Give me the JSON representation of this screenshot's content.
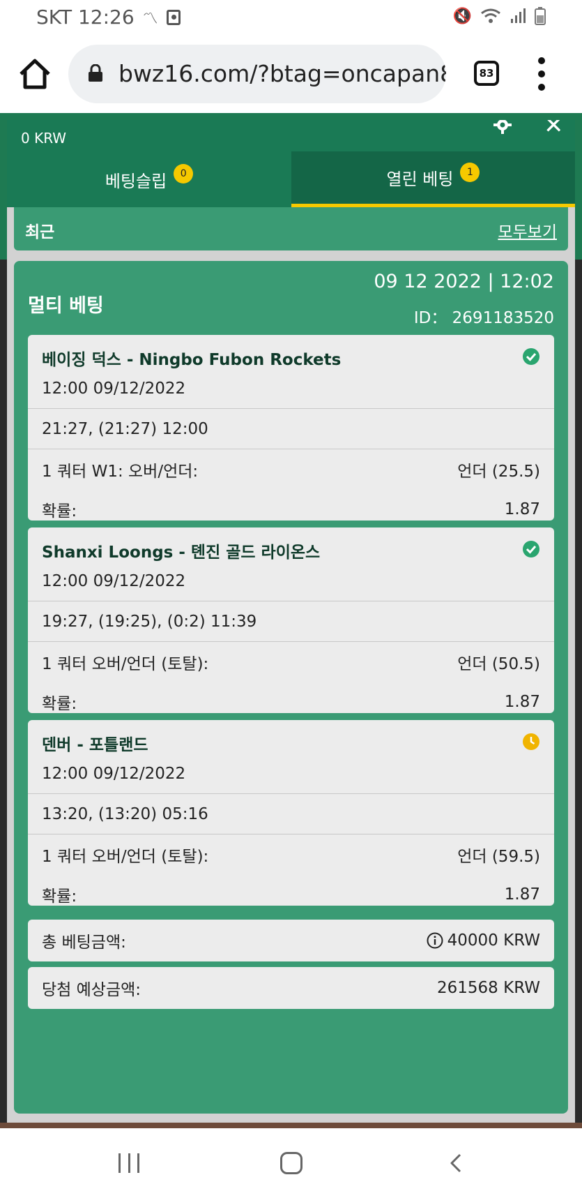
{
  "status_bar": {
    "carrier_time": "SKT 12:26",
    "icons": [
      "handwriting-icon",
      "screen-record-icon",
      "mute-icon",
      "wifi-icon",
      "signal-icon",
      "battery-icon"
    ]
  },
  "browser": {
    "url": "bwz16.com/?btag=oncapan8",
    "tab_count": "83"
  },
  "panel": {
    "balance": "0 KRW",
    "tabs": [
      {
        "label": "베팅슬립",
        "badge": "0"
      },
      {
        "label": "열린 베팅",
        "badge": "1"
      }
    ],
    "recent_title": "최근",
    "view_all": "모두보기"
  },
  "bet": {
    "type": "멀티 베팅",
    "date": "09 12 2022 | 12:02",
    "id": "ID： 2691183520",
    "events": [
      {
        "title": "베이징 덕스 - Ningbo Fubon Rockets",
        "time": "12:00   09/12/2022",
        "score": "21:27, (21:27) 12:00",
        "market_label": "1 쿼터 W1: 오버/언더:",
        "market_value": "언더 (25.5)",
        "odds_label": "확률:",
        "odds_value": "1.87",
        "status": "won",
        "status_color": "#2aa56f"
      },
      {
        "title": "Shanxi Loongs - 톈진 골드 라이온스",
        "time": "12:00   09/12/2022",
        "score": "19:27, (19:25), (0:2) 11:39",
        "market_label": "1 쿼터 오버/언더 (토탈):",
        "market_value": "언더 (50.5)",
        "odds_label": "확률:",
        "odds_value": "1.87",
        "status": "won",
        "status_color": "#2aa56f"
      },
      {
        "title": "덴버 - 포틀랜드",
        "time": "12:00   09/12/2022",
        "score": "13:20, (13:20) 05:16",
        "market_label": "1 쿼터 오버/언더 (토탈):",
        "market_value": "언더 (59.5)",
        "odds_label": "확률:",
        "odds_value": "1.87",
        "status": "pending",
        "status_color": "#f0b400"
      }
    ],
    "total_stake_label": "총 베팅금액:",
    "total_stake_value": "40000 KRW",
    "potential_win_label": "당첨 예상금액:",
    "potential_win_value": "261568 KRW"
  },
  "colors": {
    "header_green": "#1a7a55",
    "card_green": "#3a9b74",
    "active_tab_underline": "#f6c900"
  }
}
